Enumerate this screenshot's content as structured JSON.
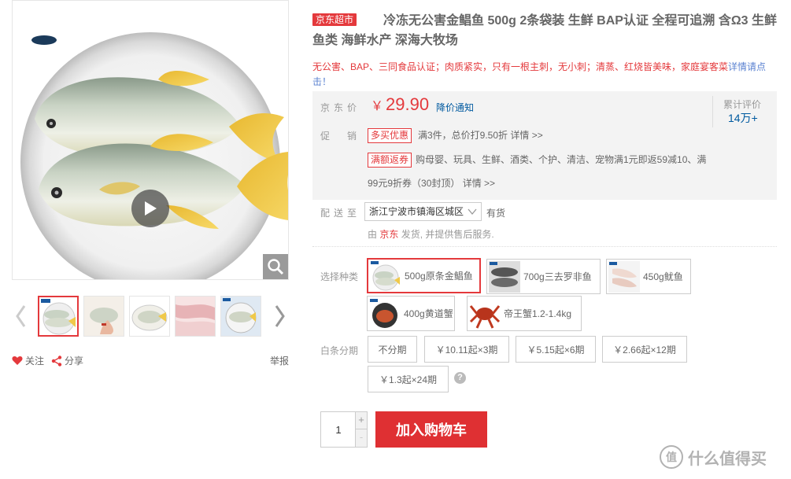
{
  "product": {
    "self_tag": "京东超市",
    "title": "冷冻无公害金鲳鱼 500g 2条袋装 生鲜 BAP认证 全程可追溯 含Ω3 生鲜鱼类 海鲜水产 深海大牧场",
    "subtitle": "无公害、BAP、三同食品认证；肉质紧实，只有一根主刺，无小刺；清蒸、红烧皆美味，家庭宴客菜",
    "subtitle_link": "详情请点击！"
  },
  "price": {
    "label": "京东价",
    "currency": "￥",
    "value": "29.90",
    "notify": "降价通知",
    "review_label": "累计评价",
    "review_count": "14万+"
  },
  "promotions": {
    "label": "促销",
    "items": [
      {
        "tag": "多买优惠",
        "text": "满3件，总价打9.50折",
        "more": "详情 >>"
      },
      {
        "tag": "满额返券",
        "text": "购母婴、玩具、生鲜、酒类、个护、清洁、宠物满1元即返59减10、满",
        "text2": "99元9折券（30封顶）",
        "more": "详情 >>"
      }
    ]
  },
  "delivery": {
    "label": "配送至",
    "address": "浙江宁波市镇海区城区",
    "stock": "有货",
    "ship_prefix": "由",
    "ship_seller": "京东",
    "ship_suffix": "发货, 并提供售后服务."
  },
  "variants": {
    "label": "选择种类",
    "items": [
      {
        "name": "500g原条金鲳鱼",
        "selected": true
      },
      {
        "name": "700g三去罗非鱼",
        "selected": false
      },
      {
        "name": "450g鱿鱼",
        "selected": false
      },
      {
        "name": "400g黄道蟹",
        "selected": false
      },
      {
        "name": "帝王蟹1.2-1.4kg",
        "selected": false
      }
    ]
  },
  "installments": {
    "label": "白条分期",
    "items": [
      "不分期",
      "￥10.11起×3期",
      "￥5.15起×6期",
      "￥2.66起×12期",
      "￥1.3起×24期"
    ],
    "help": "?"
  },
  "purchase": {
    "quantity": "1",
    "plus": "+",
    "minus": "-",
    "cart_label": "加入购物车"
  },
  "gallery": {
    "follow": "关注",
    "share": "分享",
    "report": "举报"
  },
  "watermark": {
    "logo": "值",
    "text": "什么值得买"
  },
  "colors": {
    "accent": "#e4393c",
    "link": "#005aa0"
  }
}
